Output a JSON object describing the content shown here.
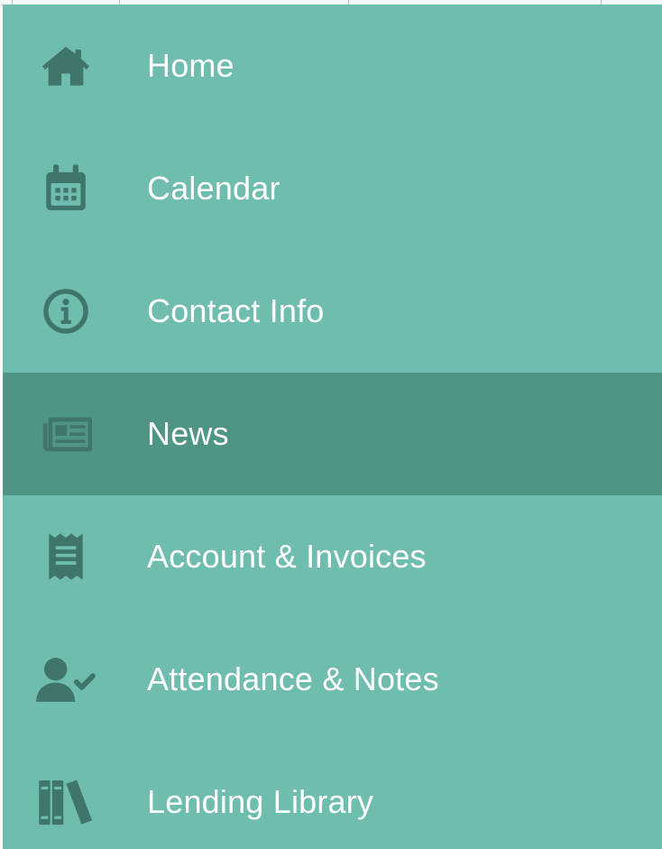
{
  "colors": {
    "drawer_background": "#6fbdae",
    "active_background": "#4f9585",
    "icon": "#3f756a",
    "label": "#ffffff"
  },
  "nav": {
    "items": [
      {
        "label": "Home",
        "icon": "home-icon",
        "active": false
      },
      {
        "label": "Calendar",
        "icon": "calendar-icon",
        "active": false
      },
      {
        "label": "Contact Info",
        "icon": "info-icon",
        "active": false
      },
      {
        "label": "News",
        "icon": "newspaper-icon",
        "active": true
      },
      {
        "label": "Account & Invoices",
        "icon": "receipt-icon",
        "active": false
      },
      {
        "label": "Attendance & Notes",
        "icon": "user-check-icon",
        "active": false
      },
      {
        "label": "Lending Library",
        "icon": "library-books-icon",
        "active": false
      }
    ]
  }
}
